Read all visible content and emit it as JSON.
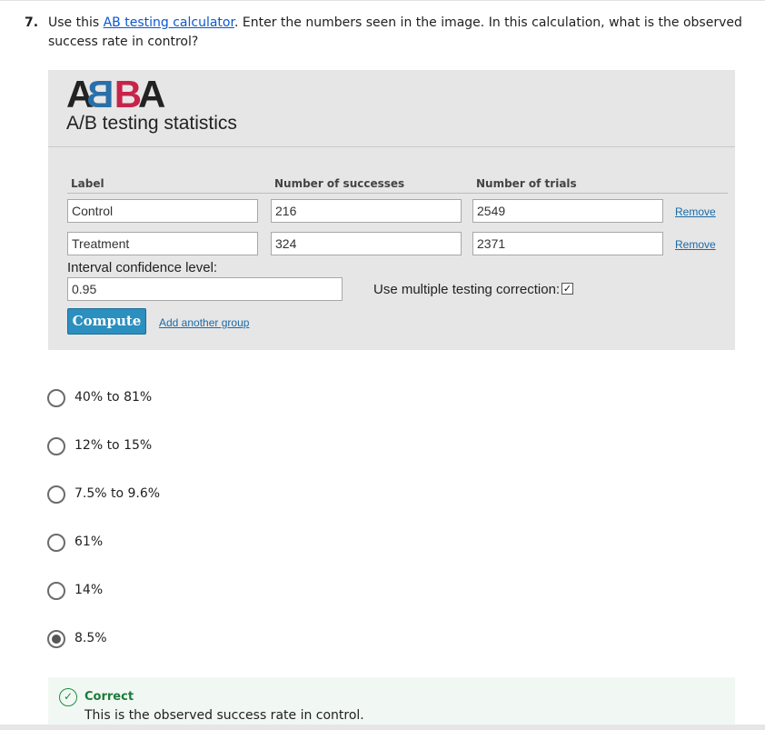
{
  "question": {
    "number": "7.",
    "text_before_link": "Use this ",
    "link_text": "AB testing calculator",
    "text_after_link": ". Enter the numbers seen in the image. In this calculation, what is the observed success rate in control?"
  },
  "calculator": {
    "logo": {
      "a1": "A",
      "b1": "B",
      "b2": "B",
      "a2": "A"
    },
    "subtitle": "A/B testing statistics",
    "headers": {
      "label": "Label",
      "successes": "Number of successes",
      "trials": "Number of trials"
    },
    "rows": [
      {
        "label": "Control",
        "successes": "216",
        "trials": "2549",
        "remove": "Remove"
      },
      {
        "label": "Treatment",
        "successes": "324",
        "trials": "2371",
        "remove": "Remove"
      }
    ],
    "confidence_label": "Interval confidence level:",
    "confidence_value": "0.95",
    "multiple_testing_label": "Use multiple testing correction:",
    "multiple_testing_checked": true,
    "check_glyph": "✓",
    "compute_label": "Compute",
    "add_group_label": "Add another group"
  },
  "options": [
    {
      "label": "40% to 81%",
      "selected": false
    },
    {
      "label": "12% to 15%",
      "selected": false
    },
    {
      "label": "7.5% to 9.6%",
      "selected": false
    },
    {
      "label": "61%",
      "selected": false
    },
    {
      "label": "14%",
      "selected": false
    },
    {
      "label": "8.5%",
      "selected": true
    }
  ],
  "feedback": {
    "icon": "check-circle-icon",
    "icon_glyph": "✓",
    "title": "Correct",
    "text": "This is the observed success rate in control."
  },
  "colors": {
    "link": "#0b57d0",
    "compute_button": "#2b8fbf",
    "correct_green": "#1e8e3e",
    "logo_blue": "#2a6fa8",
    "logo_red": "#c8234a"
  }
}
